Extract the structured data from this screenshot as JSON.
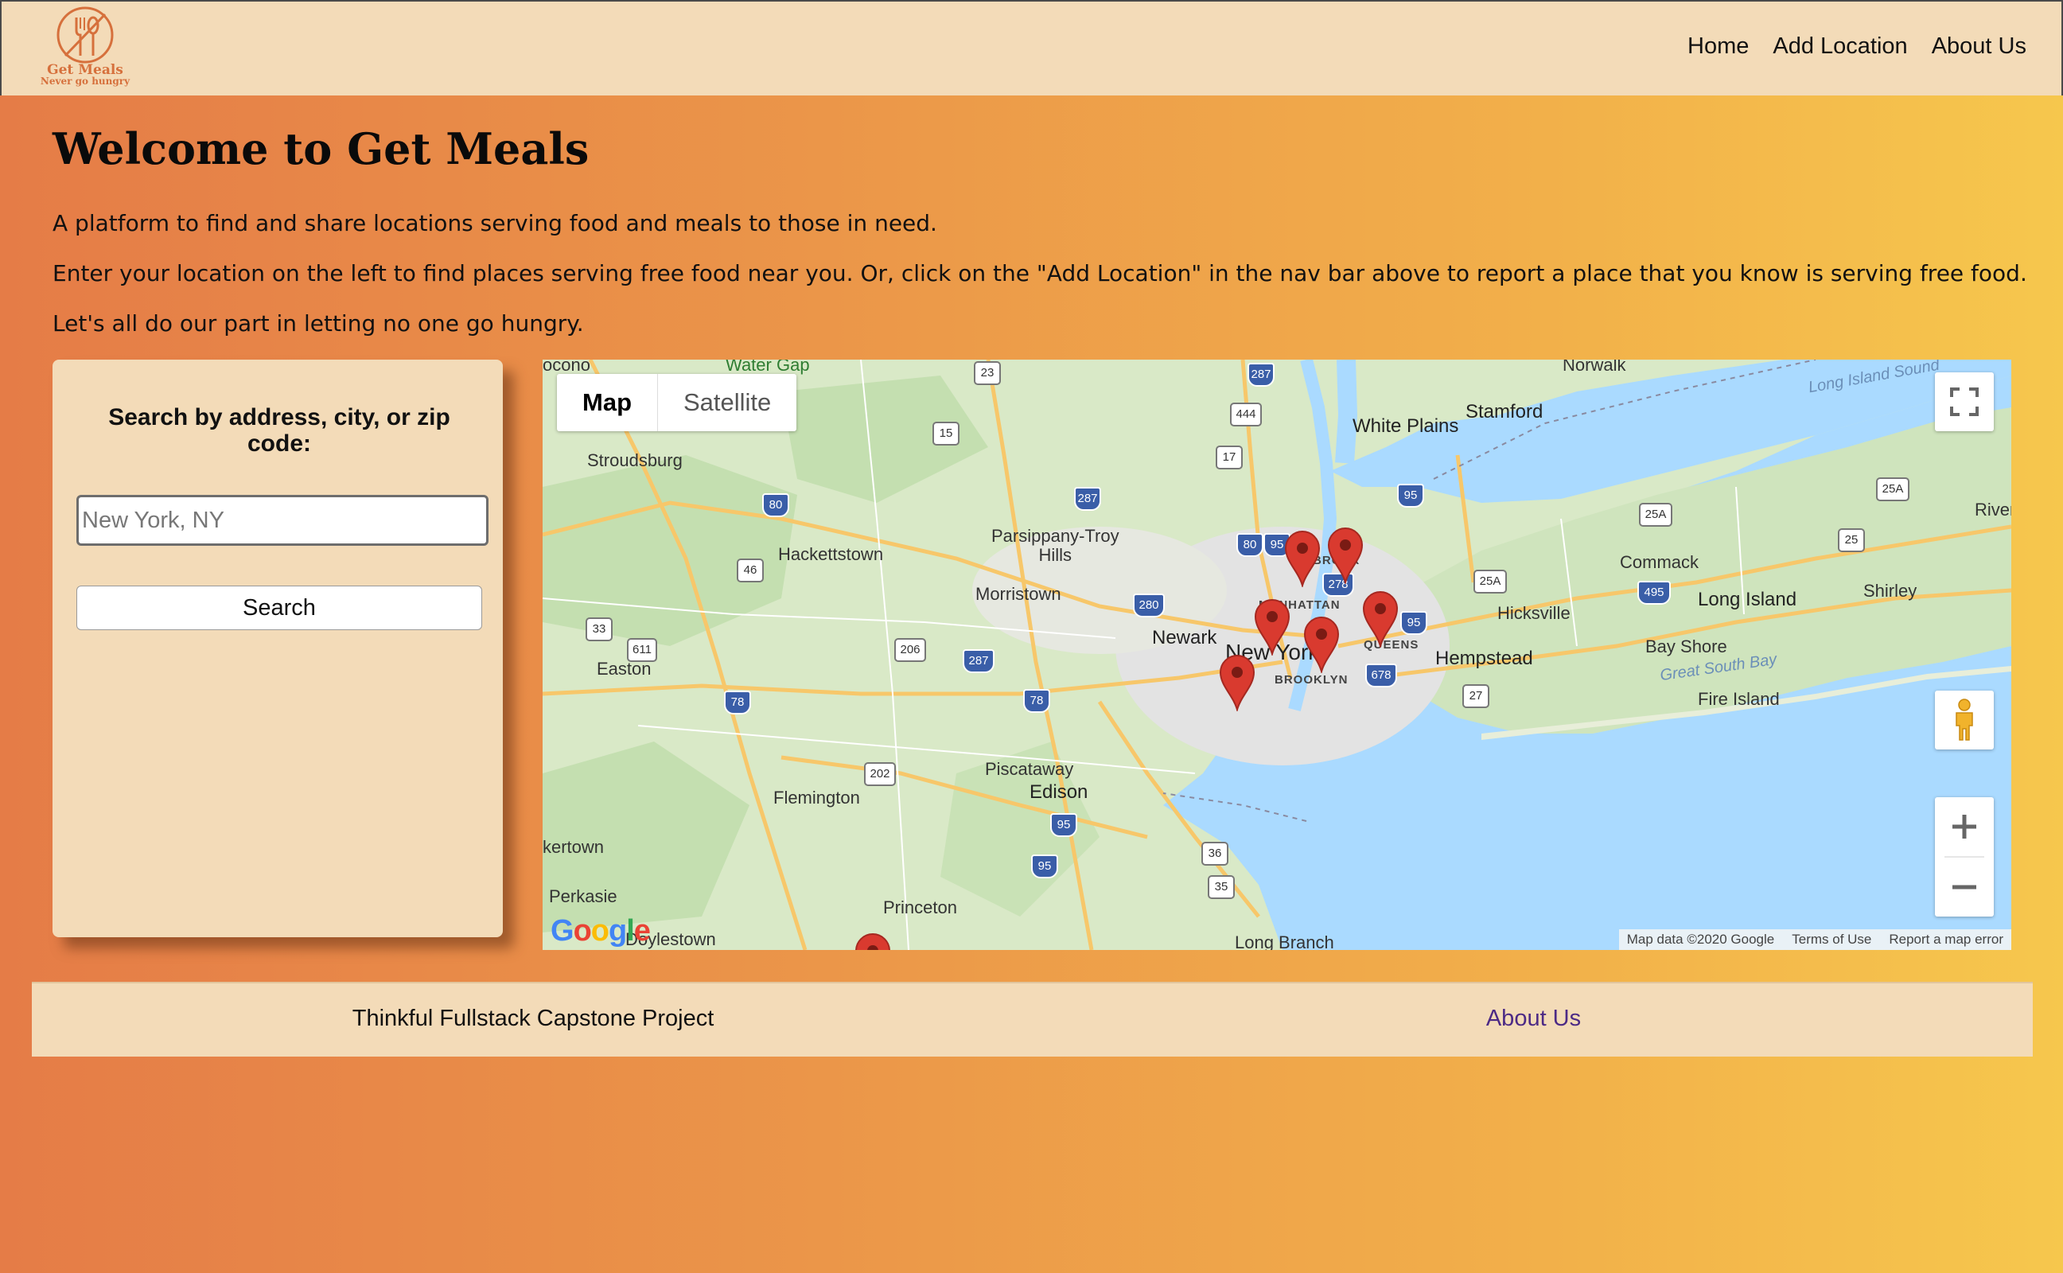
{
  "brand": {
    "name": "Get Meals",
    "tagline": "Never go hungry",
    "color": "#d6703c"
  },
  "nav": {
    "items": [
      "Home",
      "Add Location",
      "About Us"
    ]
  },
  "intro": {
    "title": "Welcome to Get Meals",
    "p1": "A platform to find and share locations serving food and meals to those in need.",
    "p2": "Enter your location on the left to find places serving free food near you. Or, click on the \"Add Location\" in the nav bar above to report a place that you know is serving free food.",
    "p3": "Let's all do our part in letting no one go hungry."
  },
  "search": {
    "title": "Search by address, city, or zip code:",
    "placeholder": "New York, NY",
    "button": "Search"
  },
  "map": {
    "type_controls": {
      "map": "Map",
      "satellite": "Satellite",
      "active": "Map"
    },
    "labels": {
      "water_gap": "Water Gap",
      "pocono": "ocono",
      "norwalk": "Norwalk",
      "long_island_sound": "Long Island Sound",
      "white_plains": "White Plains",
      "stamford": "Stamford",
      "stroudsburg": "Stroudsburg",
      "riverhead": "Riverh",
      "parsippany": "Parsippany-Troy\nHills",
      "hackettstown": "Hackettstown",
      "morristown": "Morristown",
      "commack": "Commack",
      "shirley": "Shirley",
      "long_island": "Long Island",
      "hicksville": "Hicksville",
      "newark": "Newark",
      "new_york": "New York",
      "bronx": "BRONX",
      "manhattan": "MANHATTAN",
      "queens": "QUEENS",
      "brooklyn": "BROOKLYN",
      "hempstead": "Hempstead",
      "bay_shore": "Bay Shore",
      "great_south_bay": "Great South Bay",
      "fire_island": "Fire Island",
      "easton": "Easton",
      "piscataway": "Piscataway",
      "edison": "Edison",
      "flemington": "Flemington",
      "kertown": "kertown",
      "perkasie": "Perkasie",
      "princeton": "Princeton",
      "doylestown": "Doylestown",
      "long_branch": "Long Branch"
    },
    "shields": [
      "23",
      "287",
      "444",
      "15",
      "17",
      "80",
      "287",
      "95",
      "25A",
      "25A",
      "25",
      "46",
      "80",
      "95",
      "278",
      "25A",
      "495",
      "280",
      "33",
      "611",
      "206",
      "287",
      "95",
      "678",
      "27",
      "78",
      "78",
      "202",
      "95",
      "95",
      "36",
      "35"
    ],
    "attribution": [
      "Map data ©2020 Google",
      "Terms of Use",
      "Report a map error"
    ],
    "google_logo": "Google",
    "marker_count": 7,
    "marker_color": "#d93a2f"
  },
  "footer": {
    "left": "Thinkful Fullstack Capstone Project",
    "right": "About Us"
  }
}
